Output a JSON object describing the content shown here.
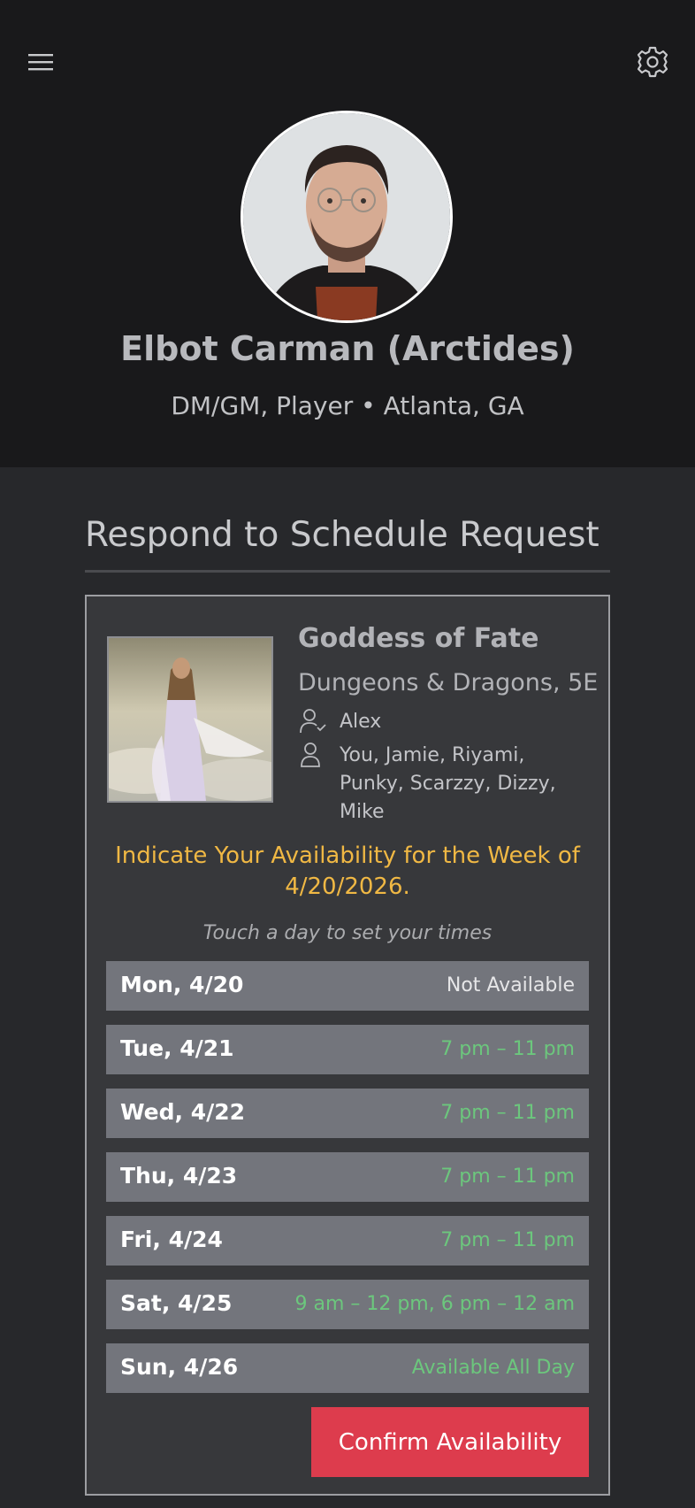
{
  "header": {
    "menu_icon": "hamburger-menu-icon",
    "settings_icon": "gear-icon",
    "profile": {
      "name": "Elbot Carman (Arctides)",
      "subtitle": "DM/GM, Player • Atlanta, GA"
    }
  },
  "section": {
    "title": "Respond to Schedule Request"
  },
  "card": {
    "game_title": "Goddess of Fate",
    "game_system": "Dungeons & Dragons, 5E",
    "dm_icon": "user-check-icon",
    "dm": "Alex",
    "players_icon": "user-icon",
    "players": "You, Jamie, Riyami, Punky, Scarzzy, Dizzy, Mike",
    "prompt": "Indicate Your Availability for the Week of 4/20/2026.",
    "hint": "Touch a day to set your times",
    "days": [
      {
        "label": "Mon, 4/20",
        "times": "Not Available"
      },
      {
        "label": "Tue, 4/21",
        "times": "7 pm – 11 pm"
      },
      {
        "label": "Wed, 4/22",
        "times": "7 pm – 11 pm"
      },
      {
        "label": "Thu, 4/23",
        "times": "7 pm – 11 pm"
      },
      {
        "label": "Fri, 4/24",
        "times": "7 pm – 11 pm"
      },
      {
        "label": "Sat, 4/25",
        "times": "9 am – 12 pm, 6 pm – 12 am"
      },
      {
        "label": "Sun, 4/26",
        "times": "Available All Day"
      }
    ],
    "confirm_label": "Confirm Availability"
  },
  "colors": {
    "header_bg": "#19191b",
    "page_bg": "#27282b",
    "card_bg": "#37383b",
    "day_row_bg": "#73757c",
    "available": "#6cc77d",
    "prompt": "#f0b844",
    "confirm": "#dd3c4d"
  }
}
